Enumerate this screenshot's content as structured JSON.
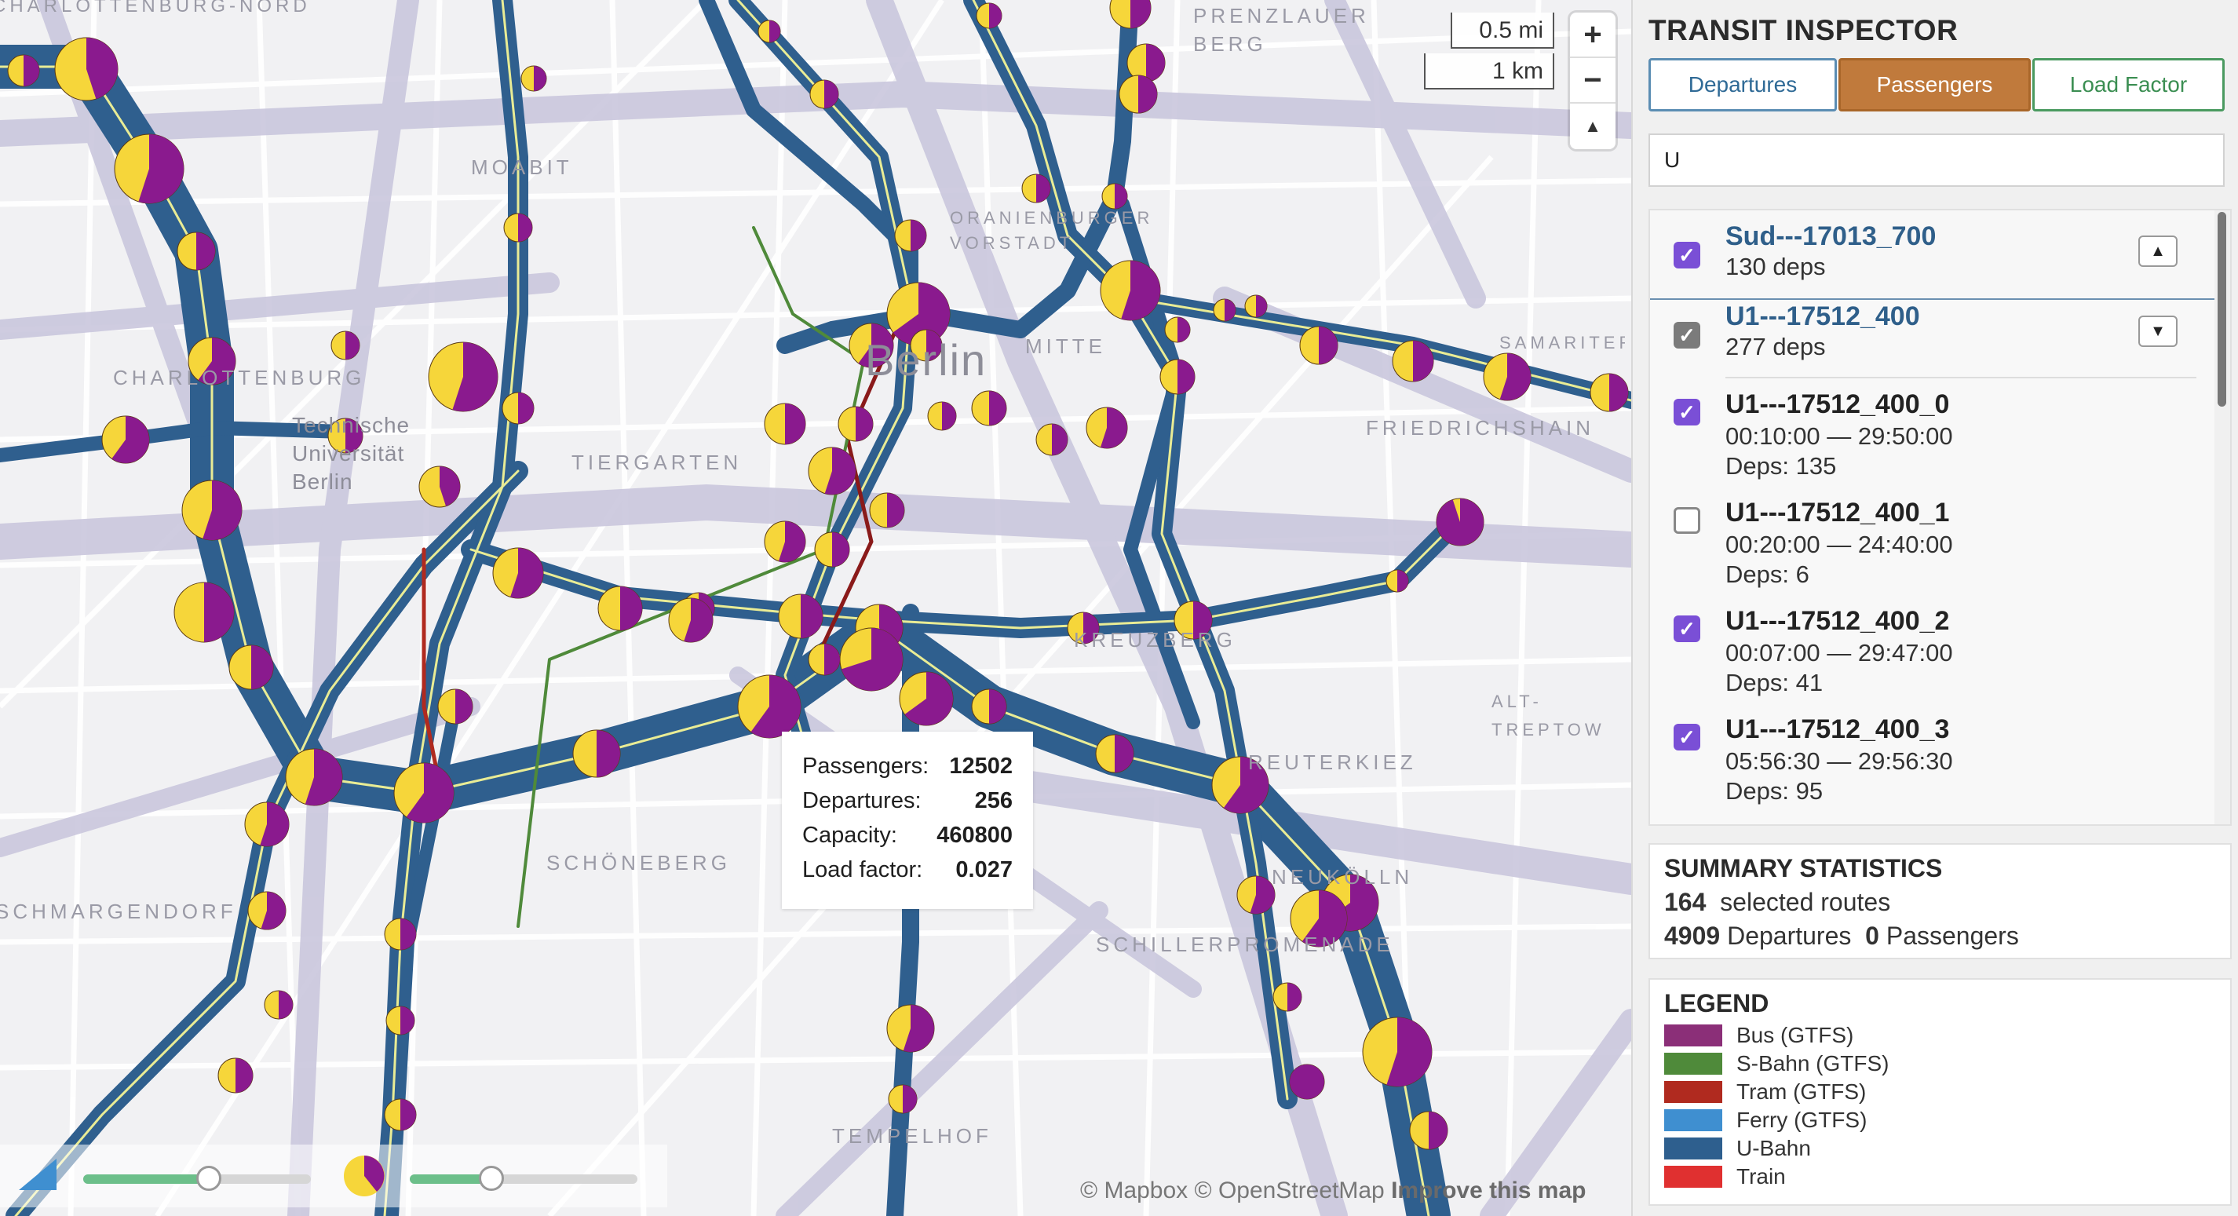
{
  "map": {
    "labels": {
      "charlottenburg_nord": "CHARLOTTENBURG-NORD",
      "prenzlauer_berg": "PRENZLAUER BERG",
      "moabit": "MOABIT",
      "oranienburger": "ORANIENBURGER VORSTADT",
      "mitte": "MITTE",
      "samariterviertel": "SAMARITERVIERTEL",
      "charlottenburg": "CHARLOTTENBURG",
      "tu": "Technische Universität Berlin",
      "tiergarten": "TIERGARTEN",
      "berlin": "Berlin",
      "friedrichshain": "FRIEDRICHSHAIN",
      "kreuzberg": "KREUZBERG",
      "treptow": "ALT-TREPTOW",
      "reuterkiez": "REUTERKIEZ",
      "schoeneberg": "SCHÖNEBERG",
      "schmargendorf": "SCHMARGENDORF",
      "neukoelln": "NEUKÖLLN",
      "schillerpromenade": "SCHILLERPROMENADE",
      "tempelhof": "TEMPELHOF"
    },
    "scale": {
      "miles": "0.5 mi",
      "km": "1 km"
    },
    "zoom": {
      "in": "+",
      "out": "−",
      "compass": "▲"
    },
    "attribution": {
      "mapbox": "© Mapbox",
      "osm": "© OpenStreetMap",
      "improve": "Improve this map"
    }
  },
  "tooltip": {
    "rows": [
      {
        "label": "Passengers:",
        "value": "12502"
      },
      {
        "label": "Departures:",
        "value": "256"
      },
      {
        "label": "Capacity:",
        "value": "460800"
      },
      {
        "label": "Load factor:",
        "value": "0.027"
      }
    ]
  },
  "sliders": {
    "width_slider_value": 0.55,
    "size_slider_value": 0.36
  },
  "panel": {
    "title": "TRANSIT INSPECTOR",
    "tabs": {
      "departures": "Departures",
      "passengers": "Passengers",
      "load_factor": "Load Factor",
      "active": "passengers"
    },
    "search": {
      "value": "U",
      "placeholder": ""
    },
    "routes": [
      {
        "name": "Sud---17013_700",
        "deps": "130 deps",
        "checked": true,
        "expanded": false
      },
      {
        "name": "U1---17512_400",
        "deps": "277 deps",
        "checked": true,
        "expanded": true,
        "variants": [
          {
            "name": "U1---17512_400_0",
            "time": "00:10:00 — 29:50:00",
            "deps": "Deps: 135",
            "checked": true
          },
          {
            "name": "U1---17512_400_1",
            "time": "00:20:00 — 24:40:00",
            "deps": "Deps: 6",
            "checked": false
          },
          {
            "name": "U1---17512_400_2",
            "time": "00:07:00 — 29:47:00",
            "deps": "Deps: 41",
            "checked": true
          },
          {
            "name": "U1---17512_400_3",
            "time": "05:56:30 — 29:56:30",
            "deps": "Deps: 95",
            "checked": true
          }
        ]
      }
    ],
    "summary": {
      "title": "SUMMARY STATISTICS",
      "routes_count": "164",
      "routes_label": "selected routes",
      "departures_count": "4909",
      "departures_label": "Departures",
      "passengers_count": "0",
      "passengers_label": "Passengers"
    },
    "legend": {
      "title": "LEGEND",
      "items": [
        {
          "label": "Bus (GTFS)",
          "color": "#8b2f78"
        },
        {
          "label": "S-Bahn (GTFS)",
          "color": "#4f8a3a"
        },
        {
          "label": "Tram (GTFS)",
          "color": "#b02a1f"
        },
        {
          "label": "Ferry (GTFS)",
          "color": "#3f8fd0"
        },
        {
          "label": "U-Bahn",
          "color": "#2e5f8e"
        },
        {
          "label": "Train",
          "color": "#e03030"
        }
      ]
    }
  },
  "colors": {
    "route_blue": "#2f5f8e",
    "route_core": "#e8e88a",
    "pie_yellow": "#f6d63a",
    "pie_purple": "#8a1a8e",
    "road_overlay": "#c9c6dc",
    "tab_active": "#c07a3c"
  }
}
